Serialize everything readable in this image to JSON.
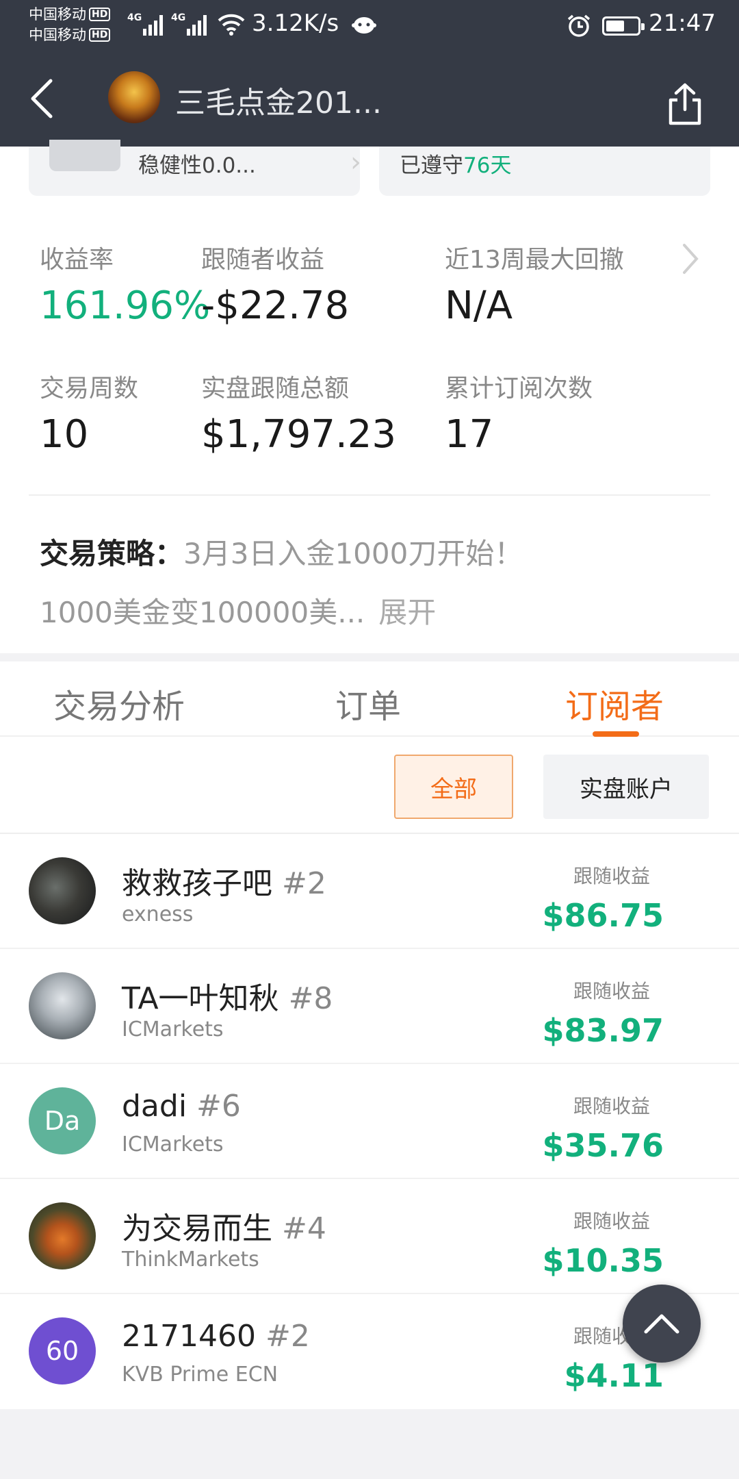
{
  "status_bar": {
    "carrier1": "中国移动",
    "carrier2": "中国移动",
    "hd_badge": "HD",
    "net_label": "4G",
    "speed": "3.12K/s",
    "time": "21:47",
    "battery_level": 0.5
  },
  "header": {
    "title": "三毛点金201...",
    "icons": [
      "back-icon",
      "share-icon"
    ]
  },
  "mini_cards": {
    "left_text": "稳健性0.0...",
    "right_prefix": "已遵守",
    "right_days": "76天"
  },
  "stats": [
    {
      "label": "收益率",
      "value": "161.96%"
    },
    {
      "label": "跟随者收益",
      "value": "-$22.78"
    },
    {
      "label": "近13周最大回撤",
      "value": "N/A"
    },
    {
      "label": "交易周数",
      "value": "10"
    },
    {
      "label": "实盘跟随总额",
      "value": "$1,797.23"
    },
    {
      "label": "累计订阅次数",
      "value": "17"
    }
  ],
  "strategy": {
    "label": "交易策略：",
    "text1": "3月3日入金1000刀开始！",
    "text2": "1000美金变100000美...",
    "expand": "展开"
  },
  "tabs": [
    "交易分析",
    "订单",
    "订阅者"
  ],
  "active_tab": "订阅者",
  "filters": {
    "all": "全部",
    "real": "实盘账户"
  },
  "subscribers": [
    {
      "name": "救救孩子吧",
      "rank": "#2",
      "broker": "exness",
      "pl_label": "跟随收益",
      "pl_value": "$86.75",
      "avatar_text": ""
    },
    {
      "name": "TA一叶知秋",
      "rank": "#8",
      "broker": "ICMarkets",
      "pl_label": "跟随收益",
      "pl_value": "$83.97",
      "avatar_text": ""
    },
    {
      "name": "dadi",
      "rank": "#6",
      "broker": "ICMarkets",
      "pl_label": "跟随收益",
      "pl_value": "$35.76",
      "avatar_text": "Da"
    },
    {
      "name": "为交易而生",
      "rank": "#4",
      "broker": "ThinkMarkets",
      "pl_label": "跟随收益",
      "pl_value": "$10.35",
      "avatar_text": ""
    },
    {
      "name": "2171460",
      "rank": "#2",
      "broker": "KVB Prime ECN",
      "pl_label": "跟随收益",
      "pl_value": "$4.11",
      "avatar_text": "60"
    }
  ],
  "colors": {
    "header_bg": "#353a45",
    "accent_orange": "#f36c18",
    "profit_green": "#12b07c"
  }
}
